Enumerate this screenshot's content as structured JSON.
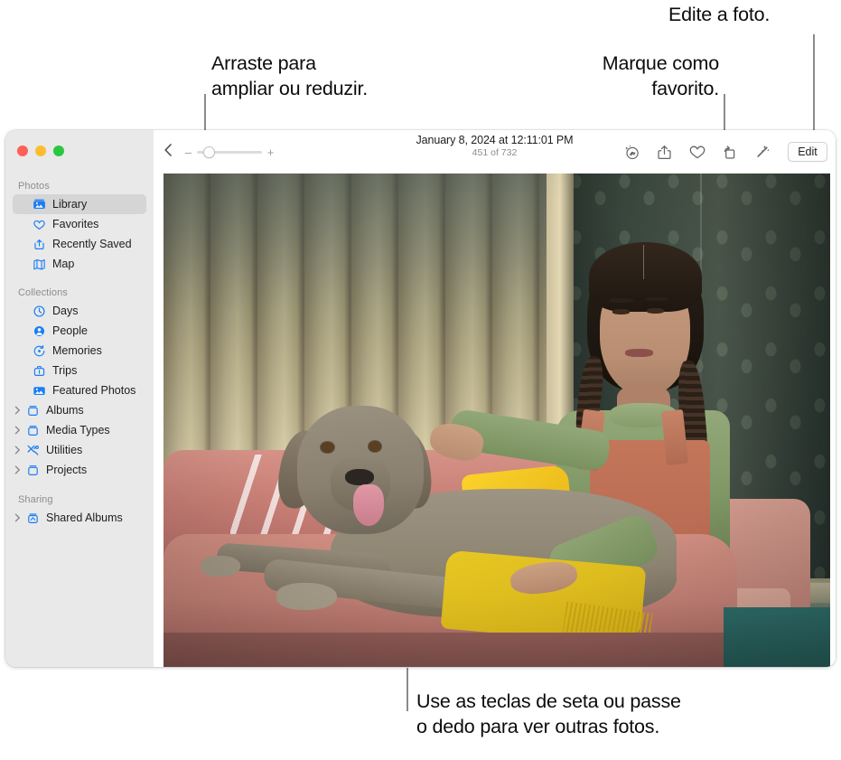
{
  "callouts": {
    "drag_zoom": "Arraste para\nampliar ou reduzir.",
    "favorite": "Marque como\nfavorito.",
    "edit": "Edite a foto.",
    "arrows": "Use as teclas de seta ou passe\no dedo para ver outras fotos."
  },
  "window": {
    "traffic_lights": {
      "close": "close-button",
      "minimize": "minimize-button",
      "zoom": "zoom-button"
    }
  },
  "sidebar": {
    "sections": [
      {
        "title": "Photos",
        "items": [
          {
            "label": "Library",
            "icon": "library-icon",
            "selected": true,
            "disclosure": false
          },
          {
            "label": "Favorites",
            "icon": "heart-icon",
            "selected": false,
            "disclosure": false
          },
          {
            "label": "Recently Saved",
            "icon": "recently-saved-icon",
            "selected": false,
            "disclosure": false
          },
          {
            "label": "Map",
            "icon": "map-icon",
            "selected": false,
            "disclosure": false
          }
        ]
      },
      {
        "title": "Collections",
        "items": [
          {
            "label": "Days",
            "icon": "clock-icon",
            "selected": false,
            "disclosure": false
          },
          {
            "label": "People",
            "icon": "person-icon",
            "selected": false,
            "disclosure": false
          },
          {
            "label": "Memories",
            "icon": "memories-icon",
            "selected": false,
            "disclosure": false
          },
          {
            "label": "Trips",
            "icon": "suitcase-icon",
            "selected": false,
            "disclosure": false
          },
          {
            "label": "Featured Photos",
            "icon": "featured-photos-icon",
            "selected": false,
            "disclosure": false
          },
          {
            "label": "Albums",
            "icon": "album-icon",
            "selected": false,
            "disclosure": true
          },
          {
            "label": "Media Types",
            "icon": "album-icon",
            "selected": false,
            "disclosure": true
          },
          {
            "label": "Utilities",
            "icon": "utilities-icon",
            "selected": false,
            "disclosure": true
          },
          {
            "label": "Projects",
            "icon": "album-icon",
            "selected": false,
            "disclosure": true
          }
        ]
      },
      {
        "title": "Sharing",
        "items": [
          {
            "label": "Shared Albums",
            "icon": "shared-album-icon",
            "selected": false,
            "disclosure": true
          }
        ]
      }
    ],
    "accent_color": "#1a7ef5",
    "background_color": "#e9e9e9"
  },
  "toolbar": {
    "back_icon": "back-chevron-icon",
    "zoom_out_label": "–",
    "zoom_in_label": "+",
    "zoom_slider_value": 10,
    "title": "January 8, 2024 at 12:11:01 PM",
    "subtitle": "451 of 732",
    "actions": [
      {
        "name": "visual-lookup-icon",
        "label": "Visual Look Up"
      },
      {
        "name": "share-icon",
        "label": "Share"
      },
      {
        "name": "heart-icon",
        "label": "Favorite"
      },
      {
        "name": "rotate-icon",
        "label": "Rotate"
      },
      {
        "name": "auto-enhance-icon",
        "label": "Auto Enhance"
      }
    ],
    "edit_label": "Edit"
  },
  "photo": {
    "alt": "Girl with braids in green shirt and rust overalls petting a Weimaraner dog on a pink couch",
    "counter": "451 of 732"
  }
}
